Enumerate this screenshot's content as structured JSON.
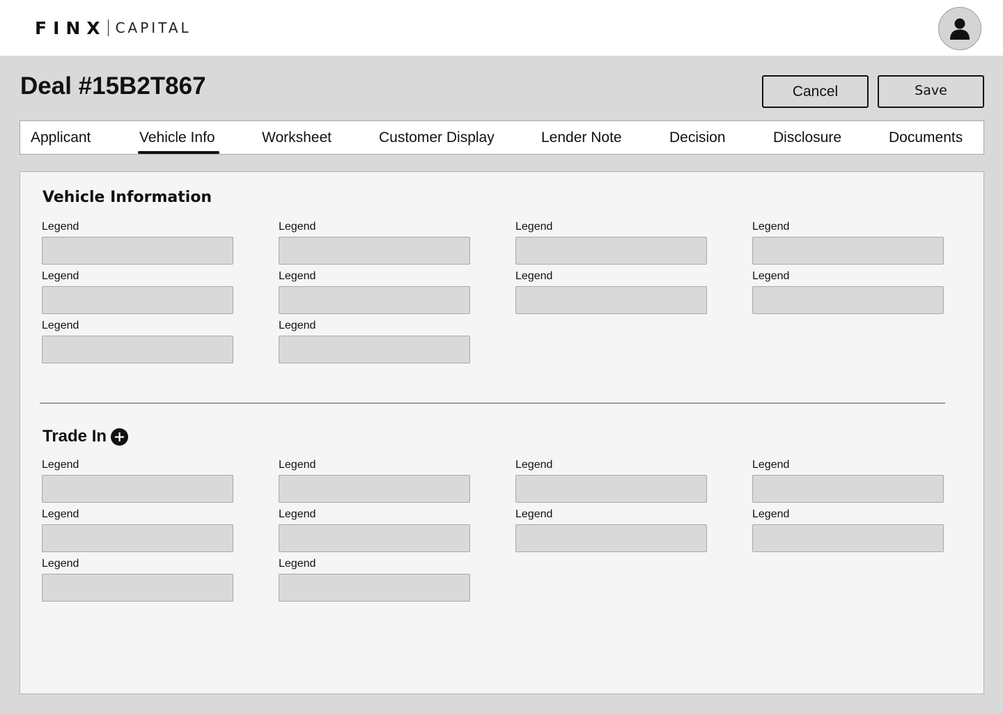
{
  "brand": {
    "name_bold": "FINX",
    "name_light": "CAPITAL"
  },
  "header": {
    "user_avatar_icon": "user-icon"
  },
  "deal": {
    "title": "Deal #15B2T867",
    "cancel_label": "Cancel",
    "save_label": "Save"
  },
  "tabs": [
    {
      "label": "Applicant",
      "active": false
    },
    {
      "label": "Vehicle Info",
      "active": true
    },
    {
      "label": "Worksheet",
      "active": false
    },
    {
      "label": "Customer Display",
      "active": false
    },
    {
      "label": "Lender Note",
      "active": false
    },
    {
      "label": "Decision",
      "active": false
    },
    {
      "label": "Disclosure",
      "active": false
    },
    {
      "label": "Documents",
      "active": false
    }
  ],
  "vehicle_info": {
    "title": "Vehicle Information",
    "fields": [
      {
        "label": "Legend",
        "value": ""
      },
      {
        "label": "Legend",
        "value": ""
      },
      {
        "label": "Legend",
        "value": ""
      },
      {
        "label": "Legend",
        "value": ""
      },
      {
        "label": "Legend",
        "value": ""
      },
      {
        "label": "Legend",
        "value": ""
      },
      {
        "label": "Legend",
        "value": ""
      },
      {
        "label": "Legend",
        "value": ""
      },
      {
        "label": "Legend",
        "value": ""
      },
      {
        "label": "Legend",
        "value": ""
      }
    ]
  },
  "trade_in": {
    "title": "Trade In",
    "add_icon": "plus-circle-icon",
    "fields": [
      {
        "label": "Legend",
        "value": ""
      },
      {
        "label": "Legend",
        "value": ""
      },
      {
        "label": "Legend",
        "value": ""
      },
      {
        "label": "Legend",
        "value": ""
      },
      {
        "label": "Legend",
        "value": ""
      },
      {
        "label": "Legend",
        "value": ""
      },
      {
        "label": "Legend",
        "value": ""
      },
      {
        "label": "Legend",
        "value": ""
      },
      {
        "label": "Legend",
        "value": ""
      },
      {
        "label": "Legend",
        "value": ""
      }
    ]
  },
  "colors": {
    "page_bg": "#d9d9d9",
    "panel_bg": "#f5f5f5",
    "field_bg": "#d9d9d9",
    "text": "#111111"
  }
}
